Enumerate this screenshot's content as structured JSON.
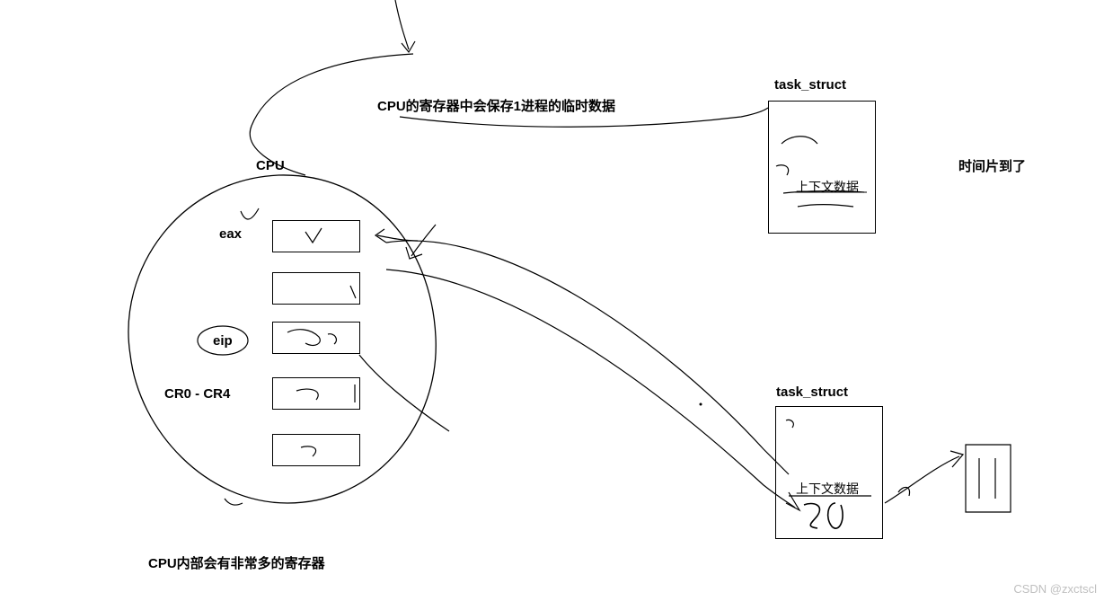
{
  "cpu": {
    "title": "CPU",
    "registers": {
      "eax": "eax",
      "eip": "eip",
      "cr": "CR0 - CR4"
    },
    "caption_top": "CPU的寄存器中会保存1进程的临时数据",
    "caption_bottom": "CPU内部会有非常多的寄存器"
  },
  "task_struct": {
    "title_upper": "task_struct",
    "title_lower": "task_struct",
    "context_label": "上下文数据",
    "scribble_number": "20"
  },
  "side_text": "时间片到了",
  "watermark": "CSDN @zxctscl"
}
